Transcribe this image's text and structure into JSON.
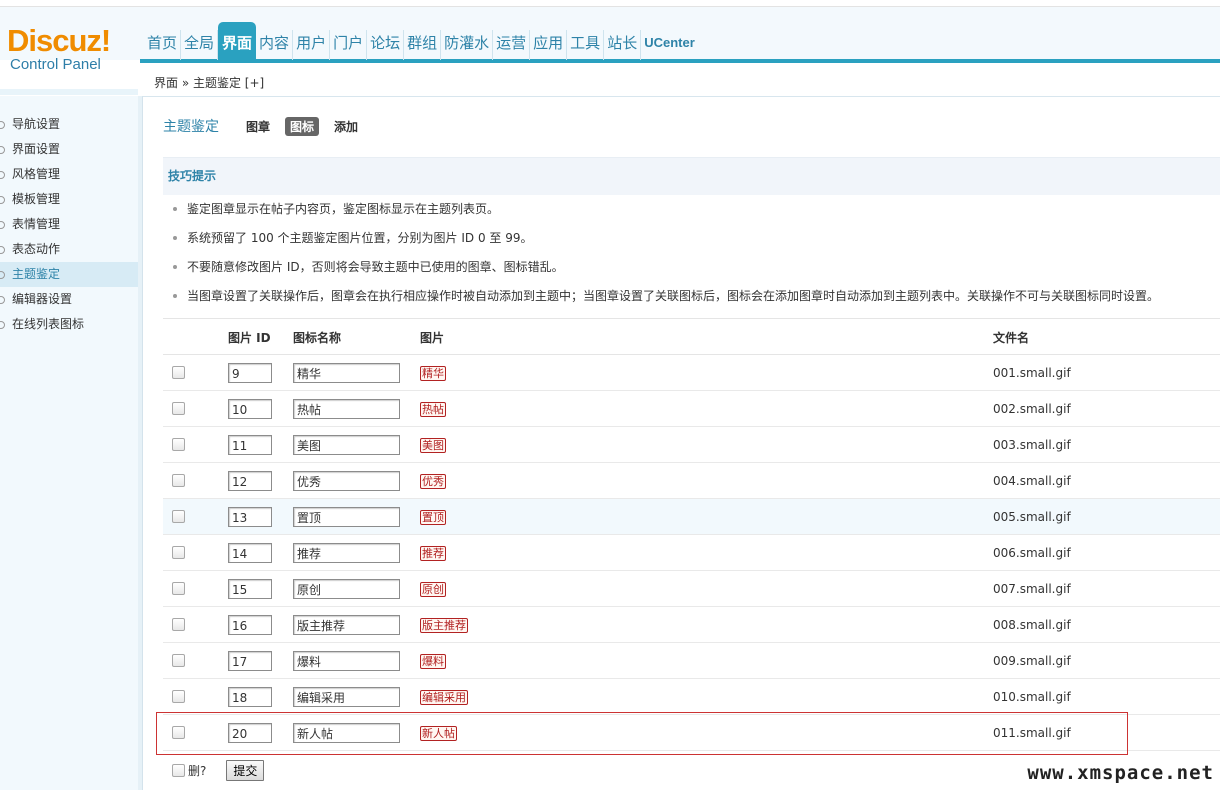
{
  "logo": {
    "brand": "Discuz",
    "bang": "!",
    "subtitle": "Control Panel"
  },
  "nav": [
    "首页",
    "全局",
    "界面",
    "内容",
    "用户",
    "门户",
    "论坛",
    "群组",
    "防灌水",
    "运营",
    "应用",
    "工具",
    "站长",
    "UCenter"
  ],
  "nav_active": "界面",
  "breadcrumb": "界面 » 主题鉴定 [+]",
  "sidebar": {
    "items": [
      "导航设置",
      "界面设置",
      "风格管理",
      "模板管理",
      "表情管理",
      "表态动作",
      "主题鉴定",
      "编辑器设置",
      "在线列表图标"
    ],
    "active": "主题鉴定"
  },
  "page": {
    "title": "主题鉴定",
    "tabs": [
      {
        "label": "图章",
        "on": false
      },
      {
        "label": "图标",
        "on": true
      },
      {
        "label": "添加",
        "on": false
      }
    ]
  },
  "tips": {
    "header": "技巧提示",
    "lines": [
      "鉴定图章显示在帖子内容页，鉴定图标显示在主题列表页。",
      "系统预留了 100 个主题鉴定图片位置，分别为图片 ID 0 至 99。",
      "不要随意修改图片 ID，否则将会导致主题中已使用的图章、图标错乱。",
      "当图章设置了关联操作后，图章会在执行相应操作时被自动添加到主题中；当图章设置了关联图标后，图标会在添加图章时自动添加到主题列表中。关联操作不可与关联图标同时设置。"
    ]
  },
  "table": {
    "headers": {
      "id": "图片 ID",
      "name": "图标名称",
      "image": "图片",
      "file": "文件名"
    },
    "rows": [
      {
        "id": "9",
        "name": "精华",
        "stamp": "精华",
        "file": "001.small.gif"
      },
      {
        "id": "10",
        "name": "热帖",
        "stamp": "热帖",
        "file": "002.small.gif"
      },
      {
        "id": "11",
        "name": "美图",
        "stamp": "美图",
        "file": "003.small.gif"
      },
      {
        "id": "12",
        "name": "优秀",
        "stamp": "优秀",
        "file": "004.small.gif"
      },
      {
        "id": "13",
        "name": "置顶",
        "stamp": "置顶",
        "file": "005.small.gif"
      },
      {
        "id": "14",
        "name": "推荐",
        "stamp": "推荐",
        "file": "006.small.gif"
      },
      {
        "id": "15",
        "name": "原创",
        "stamp": "原创",
        "file": "007.small.gif"
      },
      {
        "id": "16",
        "name": "版主推荐",
        "stamp": "版主推荐",
        "file": "008.small.gif"
      },
      {
        "id": "17",
        "name": "爆料",
        "stamp": "爆料",
        "file": "009.small.gif"
      },
      {
        "id": "18",
        "name": "编辑采用",
        "stamp": "编辑采用",
        "file": "010.small.gif"
      },
      {
        "id": "20",
        "name": "新人帖",
        "stamp": "新人帖",
        "file": "011.small.gif"
      }
    ]
  },
  "footer": {
    "delete_label": "删?",
    "submit_label": "提交"
  },
  "watermark": "www.xmspace.net",
  "colors": {
    "accent": "#2aa1c0",
    "link": "#2e83a8",
    "logo": "#f08c00",
    "stamp": "#b22222"
  }
}
